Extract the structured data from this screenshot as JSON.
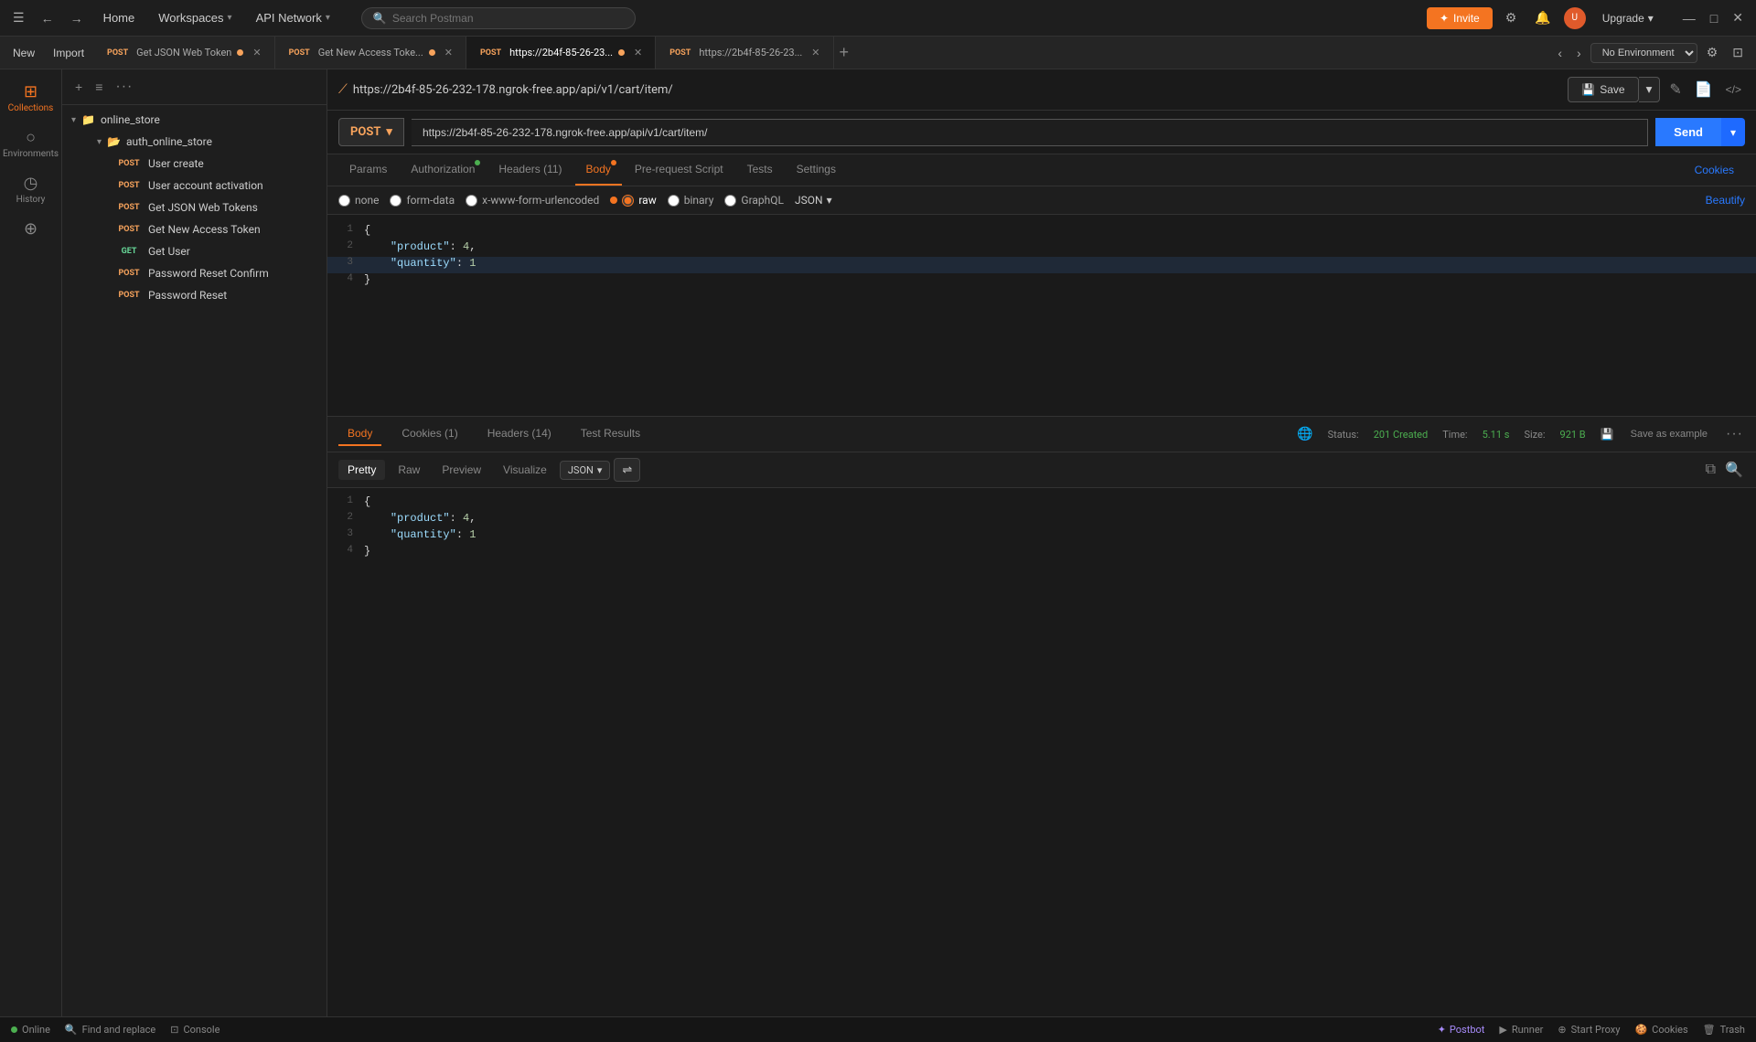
{
  "app": {
    "title": "Postman"
  },
  "topbar": {
    "menu_label": "☰",
    "back_label": "←",
    "forward_label": "→",
    "home_label": "Home",
    "workspaces_label": "Workspaces",
    "api_network_label": "API Network",
    "search_placeholder": "Search Postman",
    "invite_label": "Invite",
    "upgrade_label": "Upgrade",
    "settings_icon": "⚙",
    "bell_icon": "🔔",
    "minimize_label": "—",
    "maximize_label": "□",
    "close_label": "✕"
  },
  "tabs": {
    "new_label": "New",
    "import_label": "Import",
    "items": [
      {
        "method": "POST",
        "label": "Get JSON Web Token",
        "dot": "orange",
        "active": false
      },
      {
        "method": "POST",
        "label": "Get New Access Toke...",
        "dot": "orange",
        "active": false
      },
      {
        "method": "POST",
        "label": "https://2b4f-85-26-23...",
        "dot": "orange",
        "active": true
      },
      {
        "method": "POST",
        "label": "https://2b4f-85-26-23...",
        "dot": null,
        "active": false
      }
    ],
    "plus_label": "+",
    "env_placeholder": "No Environment"
  },
  "sidebar": {
    "items": [
      {
        "id": "collections",
        "icon": "⊞",
        "label": "Collections",
        "active": true
      },
      {
        "id": "environments",
        "icon": "○",
        "label": "Environments",
        "active": false
      },
      {
        "id": "history",
        "icon": "◷",
        "label": "History",
        "active": false
      },
      {
        "id": "plugins",
        "icon": "⊕",
        "label": "",
        "active": false
      }
    ]
  },
  "collection_panel": {
    "title": "",
    "add_icon": "+",
    "sort_icon": "≡",
    "more_icon": "···",
    "collection": {
      "name": "online_store",
      "folder": "auth_online_store",
      "items": [
        {
          "method": "POST",
          "label": "User create"
        },
        {
          "method": "POST",
          "label": "User account activation"
        },
        {
          "method": "POST",
          "label": "Get JSON Web Tokens"
        },
        {
          "method": "POST",
          "label": "Get New Access Token"
        },
        {
          "method": "GET",
          "label": "Get User"
        },
        {
          "method": "POST",
          "label": "Password Reset Confirm"
        },
        {
          "method": "POST",
          "label": "Password Reset"
        }
      ]
    }
  },
  "request_panel": {
    "url_bar": {
      "icon": "🔗",
      "url": "https://2b4f-85-26-232-178.ngrok-free.app/api/v1/cart/item/",
      "save_label": "Save",
      "edit_icon": "✎",
      "doc_icon": "📄",
      "code_icon": "</>",
      "save_chevron": "▾"
    },
    "method": "POST",
    "method_chevron": "▾",
    "url_input": "https://2b4f-85-26-232-178.ngrok-free.app/api/v1/cart/item/",
    "send_label": "Send",
    "send_chevron": "▾",
    "tabs": [
      {
        "label": "Params",
        "active": false,
        "dot": null
      },
      {
        "label": "Authorization",
        "active": false,
        "dot": "green"
      },
      {
        "label": "Headers (11)",
        "active": false,
        "dot": null
      },
      {
        "label": "Body",
        "active": true,
        "dot": "orange"
      },
      {
        "label": "Pre-request Script",
        "active": false,
        "dot": null
      },
      {
        "label": "Tests",
        "active": false,
        "dot": null
      },
      {
        "label": "Settings",
        "active": false,
        "dot": null
      }
    ],
    "cookies_label": "Cookies",
    "body_options": [
      {
        "label": "none",
        "selected": false
      },
      {
        "label": "form-data",
        "selected": false
      },
      {
        "label": "x-www-form-urlencoded",
        "selected": false
      },
      {
        "label": "raw",
        "selected": true
      },
      {
        "label": "binary",
        "selected": false
      },
      {
        "label": "GraphQL",
        "selected": false
      }
    ],
    "format_label": "JSON",
    "beautify_label": "Beautify",
    "body_code": [
      {
        "line": 1,
        "content": "{"
      },
      {
        "line": 2,
        "content": "    \"product\": 4,"
      },
      {
        "line": 3,
        "content": "    \"quantity\": 1"
      },
      {
        "line": 4,
        "content": "}"
      }
    ]
  },
  "response_panel": {
    "tabs": [
      {
        "label": "Body",
        "active": true
      },
      {
        "label": "Cookies (1)",
        "active": false
      },
      {
        "label": "Headers (14)",
        "active": false
      },
      {
        "label": "Test Results",
        "active": false
      }
    ],
    "status_label": "Status:",
    "status_value": "201 Created",
    "time_label": "Time:",
    "time_value": "5.11 s",
    "size_label": "Size:",
    "size_value": "921 B",
    "save_example_label": "Save as example",
    "more_icon": "···",
    "sub_tabs": [
      {
        "label": "Pretty",
        "active": true
      },
      {
        "label": "Raw",
        "active": false
      },
      {
        "label": "Preview",
        "active": false
      },
      {
        "label": "Visualize",
        "active": false
      }
    ],
    "format_label": "JSON",
    "format_chevron": "▾",
    "filter_icon": "⇌",
    "copy_icon": "⧉",
    "search_icon": "🔍",
    "body_code": [
      {
        "line": 1,
        "content": "{"
      },
      {
        "line": 2,
        "content": "    \"product\": 4,"
      },
      {
        "line": 3,
        "content": "    \"quantity\": 1"
      },
      {
        "line": 4,
        "content": "}"
      }
    ]
  },
  "statusbar": {
    "online_label": "Online",
    "find_replace_label": "Find and replace",
    "console_label": "Console",
    "postbot_label": "Postbot",
    "runner_label": "Runner",
    "start_proxy_label": "Start Proxy",
    "cookies_label": "Cookies",
    "trash_label": "Trash"
  }
}
